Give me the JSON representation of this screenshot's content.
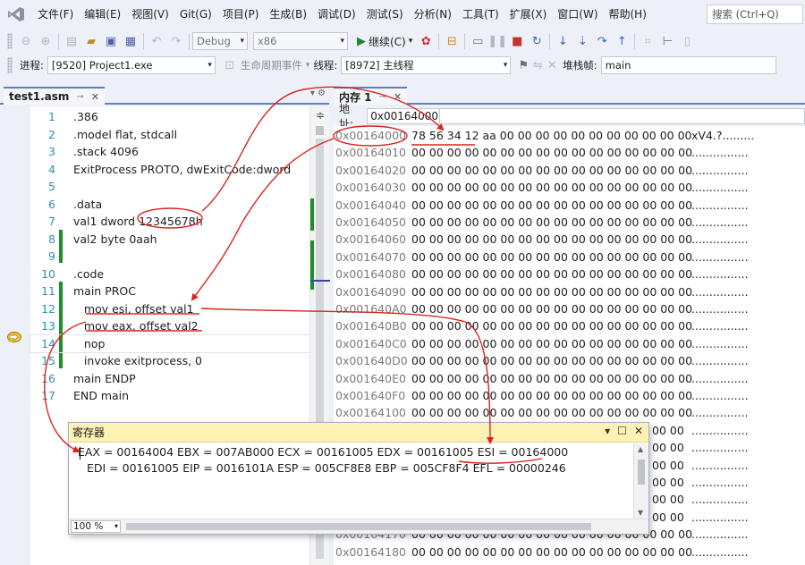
{
  "menubar": {
    "items": [
      "文件(F)",
      "编辑(E)",
      "视图(V)",
      "Git(G)",
      "项目(P)",
      "生成(B)",
      "调试(D)",
      "测试(S)",
      "分析(N)",
      "工具(T)",
      "扩展(X)",
      "窗口(W)",
      "帮助(H)"
    ],
    "search_placeholder": "搜索 (Ctrl+Q)"
  },
  "toolbar1": {
    "config": "Debug",
    "platform": "x86",
    "continue_label": "继续(C)"
  },
  "toolbar2": {
    "process_label": "进程:",
    "process_value": "[9520] Project1.exe",
    "lifecycle_label": "生命周期事件",
    "thread_label": "线程:",
    "thread_value": "[8972] 主线程",
    "stack_label": "堆栈帧:",
    "stack_value": "main"
  },
  "editor": {
    "tab_title": "test1.asm",
    "lines": [
      {
        "num": "1",
        "text": ".386"
      },
      {
        "num": "2",
        "text": ".model flat, stdcall"
      },
      {
        "num": "3",
        "text": ".stack 4096"
      },
      {
        "num": "4",
        "text": "ExitProcess PROTO, dwExitCode:dword"
      },
      {
        "num": "5",
        "text": ""
      },
      {
        "num": "6",
        "text": ".data"
      },
      {
        "num": "7",
        "text": "val1 dword 12345678h"
      },
      {
        "num": "8",
        "text": "val2 byte 0aah"
      },
      {
        "num": "9",
        "text": ""
      },
      {
        "num": "10",
        "text": ".code"
      },
      {
        "num": "11",
        "text": "main PROC"
      },
      {
        "num": "12",
        "text": "   mov esi, offset val1"
      },
      {
        "num": "13",
        "text": "   mov eax, offset val2"
      },
      {
        "num": "14",
        "text": "   nop"
      },
      {
        "num": "15",
        "text": "   invoke exitprocess, 0"
      },
      {
        "num": "16",
        "text": "main ENDP"
      },
      {
        "num": "17",
        "text": "END main"
      }
    ],
    "current_line": 14
  },
  "memory": {
    "tab_title": "内存 1",
    "address_label": "地址:",
    "address_value": "0x00164000",
    "rows": [
      {
        "addr": "0x00164000",
        "bytes": "78 56 34 12 aa 00 00 00 00 00 00 00 00 00 00 00",
        "ascii": "xV4.?........."
      },
      {
        "addr": "0x00164010",
        "bytes": "00 00 00 00 00 00 00 00 00 00 00 00 00 00 00 00",
        "ascii": "................"
      },
      {
        "addr": "0x00164020",
        "bytes": "00 00 00 00 00 00 00 00 00 00 00 00 00 00 00 00",
        "ascii": "................"
      },
      {
        "addr": "0x00164030",
        "bytes": "00 00 00 00 00 00 00 00 00 00 00 00 00 00 00 00",
        "ascii": "................"
      },
      {
        "addr": "0x00164040",
        "bytes": "00 00 00 00 00 00 00 00 00 00 00 00 00 00 00 00",
        "ascii": "................"
      },
      {
        "addr": "0x00164050",
        "bytes": "00 00 00 00 00 00 00 00 00 00 00 00 00 00 00 00",
        "ascii": "................"
      },
      {
        "addr": "0x00164060",
        "bytes": "00 00 00 00 00 00 00 00 00 00 00 00 00 00 00 00",
        "ascii": "................"
      },
      {
        "addr": "0x00164070",
        "bytes": "00 00 00 00 00 00 00 00 00 00 00 00 00 00 00 00",
        "ascii": "................"
      },
      {
        "addr": "0x00164080",
        "bytes": "00 00 00 00 00 00 00 00 00 00 00 00 00 00 00 00",
        "ascii": "................"
      },
      {
        "addr": "0x00164090",
        "bytes": "00 00 00 00 00 00 00 00 00 00 00 00 00 00 00 00",
        "ascii": "................"
      },
      {
        "addr": "0x001640A0",
        "bytes": "00 00 00 00 00 00 00 00 00 00 00 00 00 00 00 00",
        "ascii": "................"
      },
      {
        "addr": "0x001640B0",
        "bytes": "00 00 00 00 00 00 00 00 00 00 00 00 00 00 00 00",
        "ascii": "................"
      },
      {
        "addr": "0x001640C0",
        "bytes": "00 00 00 00 00 00 00 00 00 00 00 00 00 00 00 00",
        "ascii": "................"
      },
      {
        "addr": "0x001640D0",
        "bytes": "00 00 00 00 00 00 00 00 00 00 00 00 00 00 00 00",
        "ascii": "................"
      },
      {
        "addr": "0x001640E0",
        "bytes": "00 00 00 00 00 00 00 00 00 00 00 00 00 00 00 00",
        "ascii": "................"
      },
      {
        "addr": "0x001640F0",
        "bytes": "00 00 00 00 00 00 00 00 00 00 00 00 00 00 00 00",
        "ascii": "................"
      },
      {
        "addr": "0x00164100",
        "bytes": "00 00 00 00 00 00 00 00 00 00 00 00 00 00 00 00",
        "ascii": "................"
      },
      {
        "addr": "",
        "bytes": "00 00",
        "ascii": "................"
      },
      {
        "addr": "",
        "bytes": "00 00",
        "ascii": "................"
      },
      {
        "addr": "",
        "bytes": "00 00",
        "ascii": "................"
      },
      {
        "addr": "",
        "bytes": "00 00",
        "ascii": "................"
      },
      {
        "addr": "",
        "bytes": "00 00",
        "ascii": "................"
      },
      {
        "addr": "",
        "bytes": "00 00",
        "ascii": "................"
      },
      {
        "addr": "0x00164170",
        "bytes": "00 00 00 00 00 00 00 00 00 00 00 00 00 00 00 00",
        "ascii": "................"
      },
      {
        "addr": "0x00164180",
        "bytes": "00 00 00 00 00 00 00 00 00 00 00 00 00 00 00 00",
        "ascii": "................"
      }
    ]
  },
  "registers": {
    "title": "寄存器",
    "line1": "EAX = 00164004 EBX = 007AB000 ECX = 00161005 EDX = 00161005 ESI = 00164000",
    "line2": "EDI = 00161005 EIP = 0016101A ESP = 005CF8E8 EBP = 005CF8F4 EFL = 00000246",
    "zoom": "100 %"
  },
  "colors": {
    "annotation": "#d9231f",
    "change_bar": "#1e8f2b",
    "tab_accent": "#5b7ec7",
    "line_number": "#2b91af",
    "register_title_bg": "#fdf1b4"
  }
}
